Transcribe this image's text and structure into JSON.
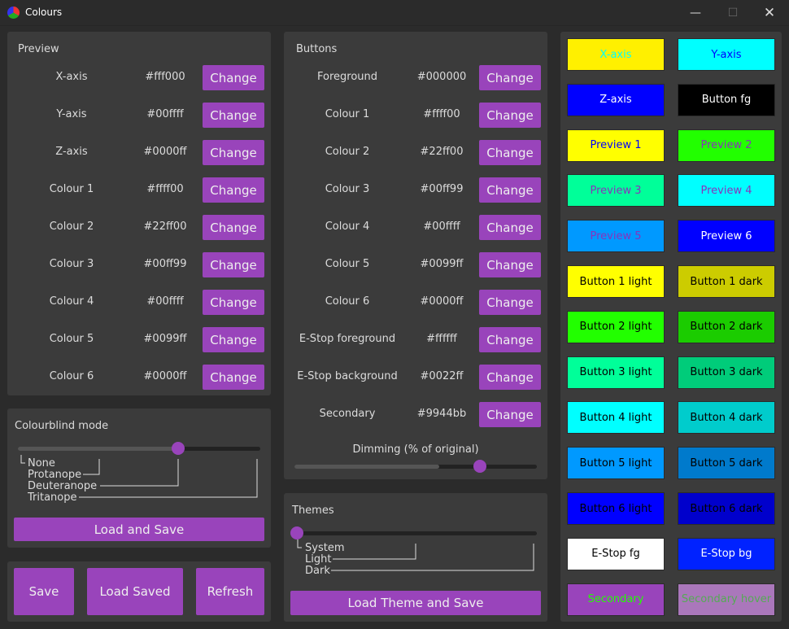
{
  "window": {
    "title": "Colours"
  },
  "preview": {
    "heading": "Preview",
    "rows": [
      {
        "name": "X-axis",
        "hex": "#fff000",
        "button": "Change"
      },
      {
        "name": "Y-axis",
        "hex": "#00ffff",
        "button": "Change"
      },
      {
        "name": "Z-axis",
        "hex": "#0000ff",
        "button": "Change"
      },
      {
        "name": "Colour 1",
        "hex": "#ffff00",
        "button": "Change"
      },
      {
        "name": "Colour 2",
        "hex": "#22ff00",
        "button": "Change"
      },
      {
        "name": "Colour 3",
        "hex": "#00ff99",
        "button": "Change"
      },
      {
        "name": "Colour 4",
        "hex": "#00ffff",
        "button": "Change"
      },
      {
        "name": "Colour 5",
        "hex": "#0099ff",
        "button": "Change"
      },
      {
        "name": "Colour 6",
        "hex": "#0000ff",
        "button": "Change"
      }
    ]
  },
  "colourblind": {
    "heading": "Colourblind mode",
    "options": [
      "None",
      "Protanope",
      "Deuteranope",
      "Tritanope"
    ],
    "selected": "Deuteranope",
    "button": "Load and Save"
  },
  "actions": {
    "save": "Save",
    "load_saved": "Load Saved",
    "refresh": "Refresh"
  },
  "buttons": {
    "heading": "Buttons",
    "rows": [
      {
        "name": "Foreground",
        "hex": "#000000",
        "button": "Change"
      },
      {
        "name": "Colour 1",
        "hex": "#ffff00",
        "button": "Change"
      },
      {
        "name": "Colour 2",
        "hex": "#22ff00",
        "button": "Change"
      },
      {
        "name": "Colour 3",
        "hex": "#00ff99",
        "button": "Change"
      },
      {
        "name": "Colour 4",
        "hex": "#00ffff",
        "button": "Change"
      },
      {
        "name": "Colour 5",
        "hex": "#0099ff",
        "button": "Change"
      },
      {
        "name": "Colour 6",
        "hex": "#0000ff",
        "button": "Change"
      },
      {
        "name": "E-Stop foreground",
        "hex": "#ffffff",
        "button": "Change"
      },
      {
        "name": "E-Stop background",
        "hex": "#0022ff",
        "button": "Change"
      },
      {
        "name": "Secondary",
        "hex": "#9944bb",
        "button": "Change"
      }
    ],
    "dimming_label": "Dimming (% of original)",
    "dimming_fraction": 0.8
  },
  "themes": {
    "heading": "Themes",
    "options": [
      "System",
      "Light",
      "Dark"
    ],
    "selected": "System",
    "button": "Load Theme and Save"
  },
  "swatches": [
    {
      "label": "X-axis",
      "bg": "#fff000",
      "fg": "#00ffff"
    },
    {
      "label": "Y-axis",
      "bg": "#00ffff",
      "fg": "#0000ff"
    },
    {
      "label": "Z-axis",
      "bg": "#0000ff",
      "fg": "#ffffff"
    },
    {
      "label": "Button fg",
      "bg": "#000000",
      "fg": "#ffffff"
    },
    {
      "label": "Preview 1",
      "bg": "#ffff00",
      "fg": "#0000ff"
    },
    {
      "label": "Preview 2",
      "bg": "#22ff00",
      "fg": "#8833bb"
    },
    {
      "label": "Preview 3",
      "bg": "#00ff99",
      "fg": "#8833bb"
    },
    {
      "label": "Preview 4",
      "bg": "#00ffff",
      "fg": "#8833bb"
    },
    {
      "label": "Preview 5",
      "bg": "#0099ff",
      "fg": "#8833bb"
    },
    {
      "label": "Preview 6",
      "bg": "#0000ff",
      "fg": "#ffffff"
    },
    {
      "label": "Button 1 light",
      "bg": "#ffff00",
      "fg": "#000000"
    },
    {
      "label": "Button 1 dark",
      "bg": "#cccc00",
      "fg": "#000000"
    },
    {
      "label": "Button 2 light",
      "bg": "#22ff00",
      "fg": "#000000"
    },
    {
      "label": "Button 2 dark",
      "bg": "#1bcc00",
      "fg": "#000000"
    },
    {
      "label": "Button 3 light",
      "bg": "#00ff99",
      "fg": "#000000"
    },
    {
      "label": "Button 3 dark",
      "bg": "#00cc7a",
      "fg": "#000000"
    },
    {
      "label": "Button 4 light",
      "bg": "#00ffff",
      "fg": "#000000"
    },
    {
      "label": "Button 4 dark",
      "bg": "#00cccc",
      "fg": "#000000"
    },
    {
      "label": "Button 5 light",
      "bg": "#0099ff",
      "fg": "#000000"
    },
    {
      "label": "Button 5 dark",
      "bg": "#007acc",
      "fg": "#000000"
    },
    {
      "label": "Button 6 light",
      "bg": "#0000ff",
      "fg": "#000000"
    },
    {
      "label": "Button 6 dark",
      "bg": "#0000cc",
      "fg": "#000000"
    },
    {
      "label": "E-Stop fg",
      "bg": "#ffffff",
      "fg": "#000000"
    },
    {
      "label": "E-Stop bg",
      "bg": "#0022ff",
      "fg": "#ffffff"
    },
    {
      "label": "Secondary",
      "bg": "#9944bb",
      "fg": "#22ff00"
    },
    {
      "label": "Secondary hover",
      "bg": "#aa77bb",
      "fg": "#55aa55"
    }
  ]
}
